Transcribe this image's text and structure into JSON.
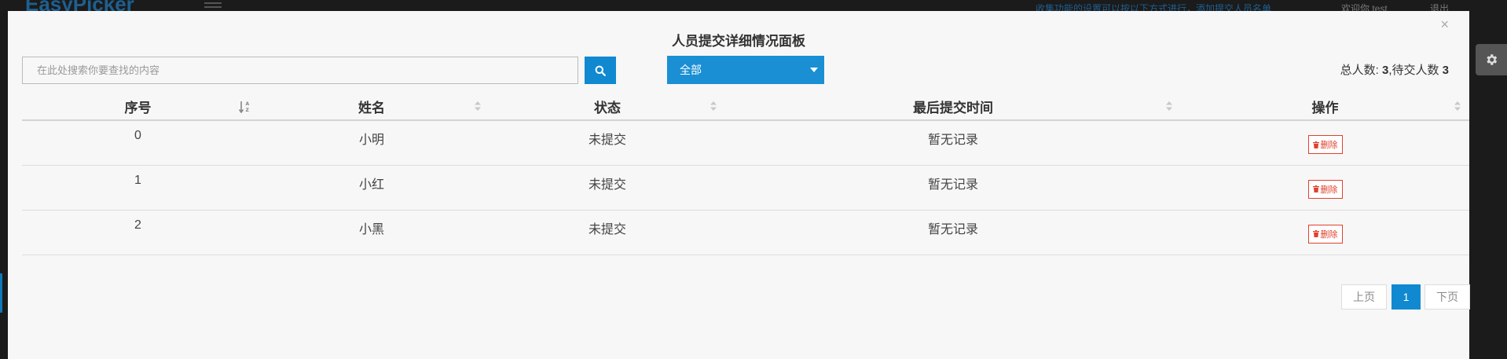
{
  "background": {
    "logo": "EasyPicker",
    "link": "收集功能的设置可以按以下方式进行，添加提交人员名单",
    "welcome": "欢迎你 test",
    "logout": "退出"
  },
  "modal": {
    "title": "人员提交详细情况面板",
    "close_label": "×",
    "search": {
      "placeholder": "在此处搜索你要查找的内容",
      "value": ""
    },
    "filter": {
      "selected": "全部"
    },
    "stats": {
      "total_label": "总人数:",
      "total": "3",
      "pending_label": ",待交人数",
      "pending": "3"
    },
    "table": {
      "headers": [
        "序号",
        "姓名",
        "状态",
        "最后提交时间",
        "操作"
      ],
      "rows": [
        {
          "index": "0",
          "name": "小明",
          "status": "未提交",
          "time": "暂无记录",
          "action": "删除"
        },
        {
          "index": "1",
          "name": "小红",
          "status": "未提交",
          "time": "暂无记录",
          "action": "删除"
        },
        {
          "index": "2",
          "name": "小黑",
          "status": "未提交",
          "time": "暂无记录",
          "action": "删除"
        }
      ]
    },
    "pagination": {
      "prev": "上页",
      "current": "1",
      "next": "下页"
    }
  },
  "colors": {
    "accent": "#1089d0",
    "danger": "#e0412c",
    "modal_bg": "#f7f7f7"
  }
}
